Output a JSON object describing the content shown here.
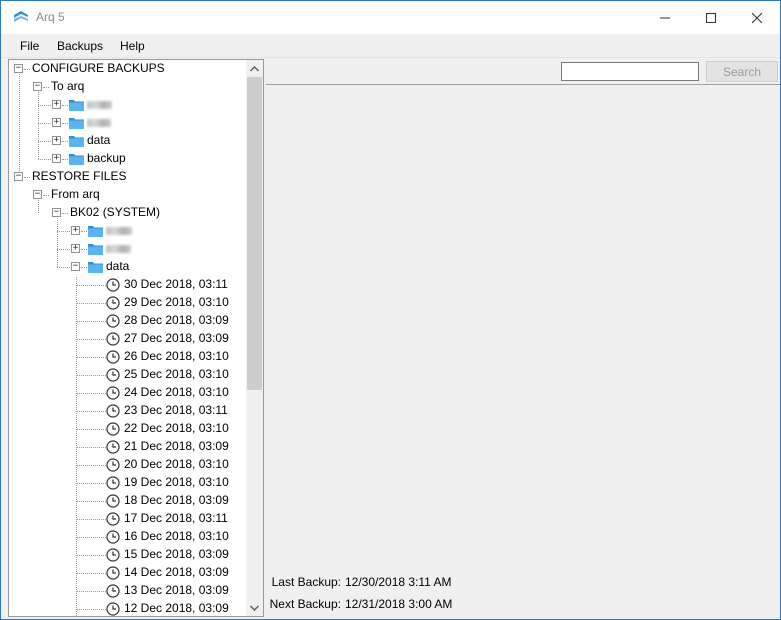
{
  "window": {
    "title": "Arq 5"
  },
  "menu": [
    "File",
    "Backups",
    "Help"
  ],
  "tree": {
    "configure": {
      "label": "CONFIGURE BACKUPS",
      "destination": "To arq",
      "folders": [
        "",
        "",
        "data",
        "backup"
      ]
    },
    "restore": {
      "label": "RESTORE FILES",
      "source": "From arq",
      "computer": "BK02 (SYSTEM)",
      "folders": [
        "",
        "",
        "data"
      ],
      "snapshots": [
        "30 Dec 2018, 03:11",
        "29 Dec 2018, 03:10",
        "28 Dec 2018, 03:09",
        "27 Dec 2018, 03:09",
        "26 Dec 2018, 03:10",
        "25 Dec 2018, 03:10",
        "24 Dec 2018, 03:10",
        "23 Dec 2018, 03:11",
        "22 Dec 2018, 03:10",
        "21 Dec 2018, 03:09",
        "20 Dec 2018, 03:10",
        "19 Dec 2018, 03:10",
        "18 Dec 2018, 03:09",
        "17 Dec 2018, 03:11",
        "16 Dec 2018, 03:10",
        "15 Dec 2018, 03:09",
        "14 Dec 2018, 03:09",
        "13 Dec 2018, 03:09",
        "12 Dec 2018, 03:09"
      ]
    }
  },
  "search": {
    "value": "",
    "button_label": "Search"
  },
  "status": {
    "last_backup_label": "Last Backup:",
    "last_backup_value": "12/30/2018 3:11 AM",
    "next_backup_label": "Next Backup:",
    "next_backup_value": "12/31/2018 3:00 AM"
  },
  "colors": {
    "folder": "#5ab4f0",
    "folder_dark": "#2d8fd5",
    "accent": "#2b78c4"
  }
}
